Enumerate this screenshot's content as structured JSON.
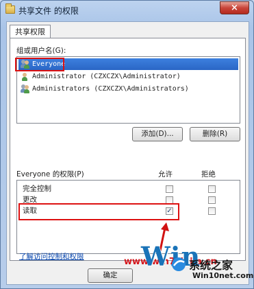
{
  "window": {
    "title": "共享文件 的权限",
    "close_label": "×"
  },
  "tab": {
    "label": "共享权限"
  },
  "users": {
    "label": "组或用户名(G):",
    "items": [
      {
        "name": "Everyone",
        "selected": true
      },
      {
        "name": "Administrator (CZXCZX\\Administrator)",
        "selected": false
      },
      {
        "name": "Administrators (CZXCZX\\Administrators)",
        "selected": false
      }
    ]
  },
  "buttons": {
    "add": "添加(D)...",
    "remove": "删除(R)",
    "ok": "确定"
  },
  "permissions": {
    "label": "Everyone 的权限(P)",
    "allow_header": "允许",
    "deny_header": "拒绝",
    "rows": [
      {
        "name": "完全控制",
        "allow": false,
        "deny": false
      },
      {
        "name": "更改",
        "allow": false,
        "deny": false
      },
      {
        "name": "读取",
        "allow": true,
        "deny": false
      }
    ]
  },
  "link": {
    "label": "了解访问控制和权限"
  },
  "watermark": {
    "text": "www.win7zhijia.cn"
  },
  "logo": {
    "big": "Win",
    "cn": "系统之家",
    "url": "Win10net.com"
  },
  "colors": {
    "highlight": "#d11111",
    "selection": "#2a66c5",
    "link": "#0645ad"
  }
}
